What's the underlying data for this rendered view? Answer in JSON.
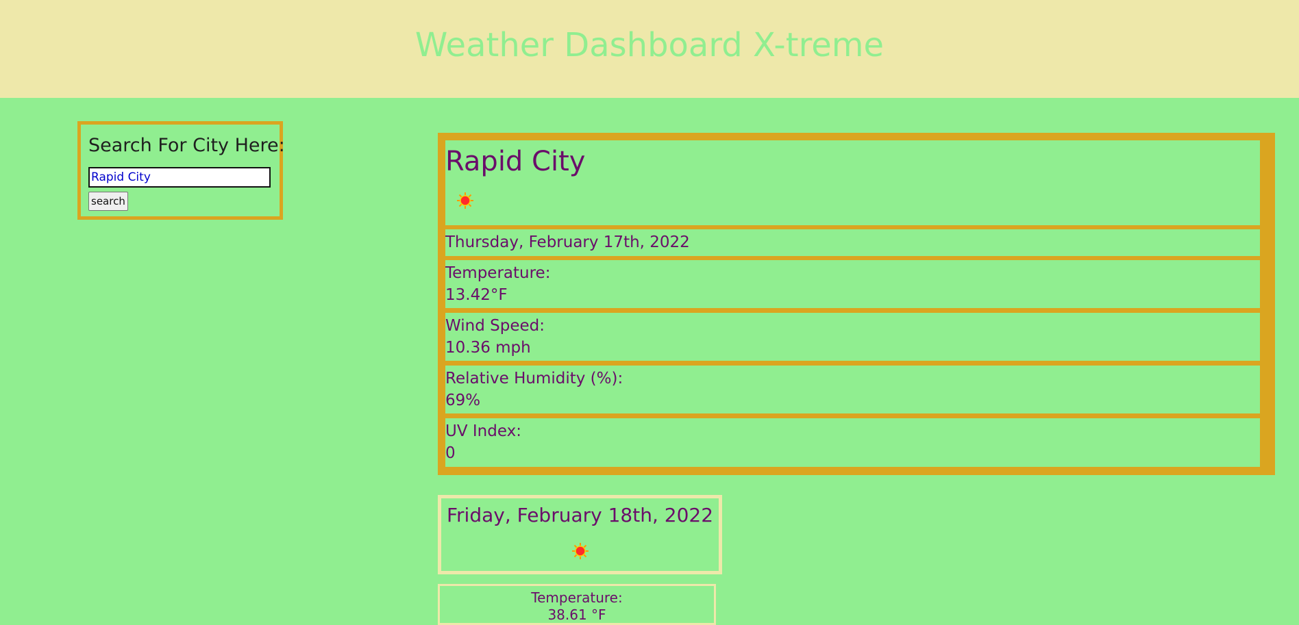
{
  "header": {
    "title": "Weather Dashboard X-treme"
  },
  "search": {
    "title": "Search For City Here:",
    "input_value": "Rapid City",
    "button_label": "search"
  },
  "current": {
    "city": "Rapid City",
    "icon": "sun-icon",
    "date": "Thursday, February 17th, 2022",
    "temperature_label": "Temperature:",
    "temperature_value": "13.42°F",
    "wind_label": "Wind Speed:",
    "wind_value": "10.36 mph",
    "humidity_label": "Relative Humidity (%):",
    "humidity_value": "69%",
    "uv_label": "UV Index:",
    "uv_value": "0"
  },
  "forecast": [
    {
      "date": "Friday, February 18th, 2022",
      "icon": "sun-icon",
      "temperature_label": "Temperature:",
      "temperature_value": "38.61 °F"
    }
  ],
  "colors": {
    "header_bg": "#eee8aa",
    "page_bg": "#90ee90",
    "accent_border": "#daa520",
    "text_purple": "#6a0d6a"
  }
}
